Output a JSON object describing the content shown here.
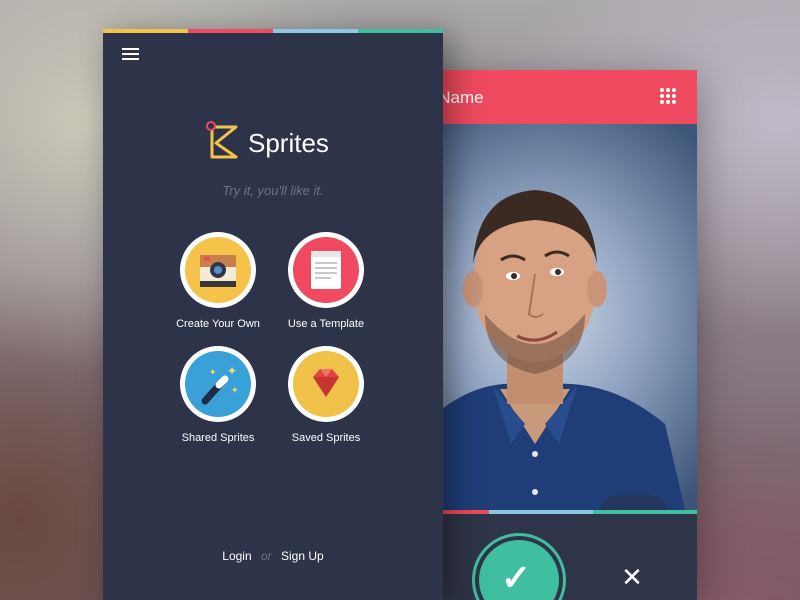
{
  "colors": {
    "accent_yellow": "#f6c34a",
    "accent_red": "#ef4a5f",
    "accent_blue": "#8fc7e6",
    "accent_teal": "#3fbf9f",
    "panel_bg": "#2d3449"
  },
  "top_strip": [
    "#f6c34a",
    "#ef4a5f",
    "#8fc7e6",
    "#3fbf9f"
  ],
  "left": {
    "menu_icon": "hamburger-menu-icon",
    "logo_icon": "sprites-logo-icon",
    "app_title": "Sprites",
    "tagline": "Try it, you'll like it.",
    "tiles": [
      {
        "label": "Create Your Own",
        "icon": "camera-icon"
      },
      {
        "label": "Use a Template",
        "icon": "document-icon"
      },
      {
        "label": "Shared Sprites",
        "icon": "magic-wand-icon"
      },
      {
        "label": "Saved Sprites",
        "icon": "gem-icon"
      }
    ],
    "auth": {
      "login": "Login",
      "or": "or",
      "signup": "Sign Up"
    }
  },
  "right": {
    "header_title": "y Name",
    "grid_icon": "grid-icon",
    "actions": {
      "wand_icon": "wand-sparkle-icon",
      "more_icon": "more-dots-icon"
    },
    "bottom_strip": [
      "#ef4a5f",
      "#8fc7e6",
      "#3fbf9f"
    ],
    "confirm_icon": "check-icon",
    "cancel_icon": "close-icon"
  }
}
